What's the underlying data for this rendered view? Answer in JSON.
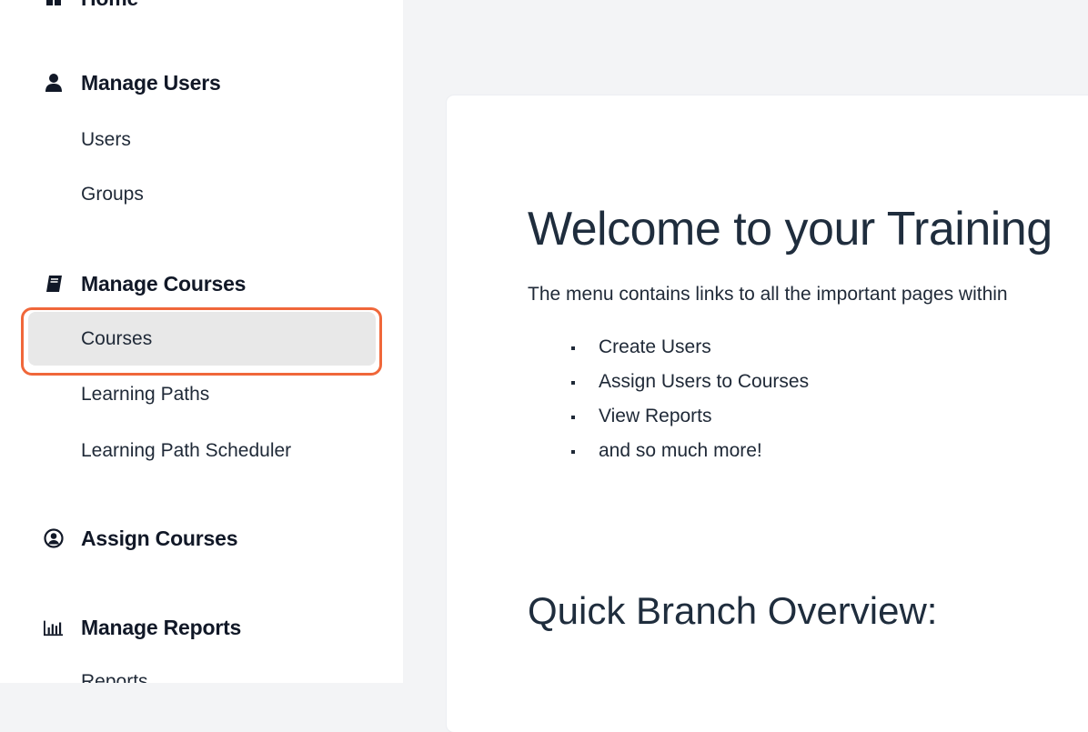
{
  "sidebar": {
    "home_label": "Home",
    "sections": [
      {
        "label": "Manage Users",
        "icon": "user-icon",
        "items": [
          "Users",
          "Groups"
        ]
      },
      {
        "label": "Manage Courses",
        "icon": "book-icon",
        "items": [
          "Courses",
          "Learning Paths",
          "Learning Path Scheduler"
        ]
      },
      {
        "label": "Assign Courses",
        "icon": "user-circle-icon",
        "items": []
      },
      {
        "label": "Manage Reports",
        "icon": "bar-chart-icon",
        "items": [
          "Reports"
        ]
      }
    ],
    "active_item": "Courses",
    "highlight_color": "#f0673a"
  },
  "main": {
    "title": "Welcome to your Training",
    "intro": "The menu contains links to all the important pages within",
    "bullets": [
      "Create Users",
      "Assign Users to Courses",
      "View Reports",
      "and so much more!"
    ],
    "subtitle": "Quick Branch Overview:"
  }
}
